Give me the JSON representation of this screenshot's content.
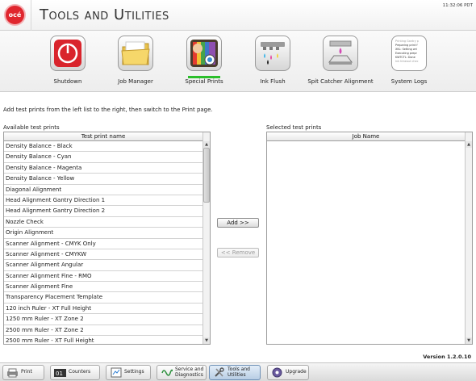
{
  "header": {
    "logo_text": "océ",
    "title": "Tools and Utilities",
    "time": "11:32:06 PDT"
  },
  "toolbar": {
    "items": [
      {
        "label": "Shutdown",
        "icon": "power-icon"
      },
      {
        "label": "Job Manager",
        "icon": "folder-icon"
      },
      {
        "label": "Special Prints",
        "icon": "special-prints-icon"
      },
      {
        "label": "Ink Flush",
        "icon": "ink-flush-icon"
      },
      {
        "label": "Spit Catcher Alignment",
        "icon": "spit-catcher-icon"
      },
      {
        "label": "System Logs",
        "icon": "system-logs-icon"
      }
    ],
    "active": "Special Prints",
    "logs_preview": [
      "Printing Gantry p",
      "Preparing print f",
      "XKL: Setting wri",
      "Executing prepr",
      "KWTCTL: Done",
      "Ink timeout chec"
    ]
  },
  "instruction": "Add test prints from the left list to the right, then switch to the Print page.",
  "available": {
    "caption": "Available test prints",
    "column_header": "Test print name",
    "rows": [
      "Density Balance - Black",
      "Density Balance - Cyan",
      "Density Balance - Magenta",
      "Density Balance - Yellow",
      "Diagonal Alignment",
      "Head Alignment Gantry Direction 1",
      "Head Alignment Gantry Direction 2",
      "Nozzle Check",
      "Origin Alignment",
      "Scanner Alignment - CMYK Only",
      "Scanner Alignment - CMYKW",
      "Scanner Alignment Angular",
      "Scanner Alignment Fine - RMO",
      "Scanner Alignment Fine",
      "Transparency Placement Template",
      "120 inch Ruler - XT Full Height",
      "1250 mm Ruler - XT Zone 2",
      "2500 mm Ruler - XT Zone 2",
      "2500 mm Ruler - XT Full Height"
    ]
  },
  "selected": {
    "caption": "Selected test prints",
    "column_header": "Job Name",
    "rows": []
  },
  "buttons": {
    "add": "Add >>",
    "remove": "<< Remove"
  },
  "version": "Version 1.2.0.10",
  "nav": {
    "tabs": [
      {
        "label": "Print",
        "icon": "print-icon"
      },
      {
        "label": "Counters",
        "icon": "counters-icon"
      },
      {
        "label": "Settings",
        "icon": "settings-icon"
      },
      {
        "label": "Service and Diagnostics",
        "icon": "service-icon"
      },
      {
        "label": "Tools and Utilities",
        "icon": "tools-icon"
      },
      {
        "label": "Upgrade",
        "icon": "upgrade-icon"
      }
    ],
    "active": "Tools and Utilities"
  },
  "colors": {
    "logo_red": "#e0262e",
    "active_underline": "#2bbf2b",
    "active_tab": "#b8cde4"
  }
}
